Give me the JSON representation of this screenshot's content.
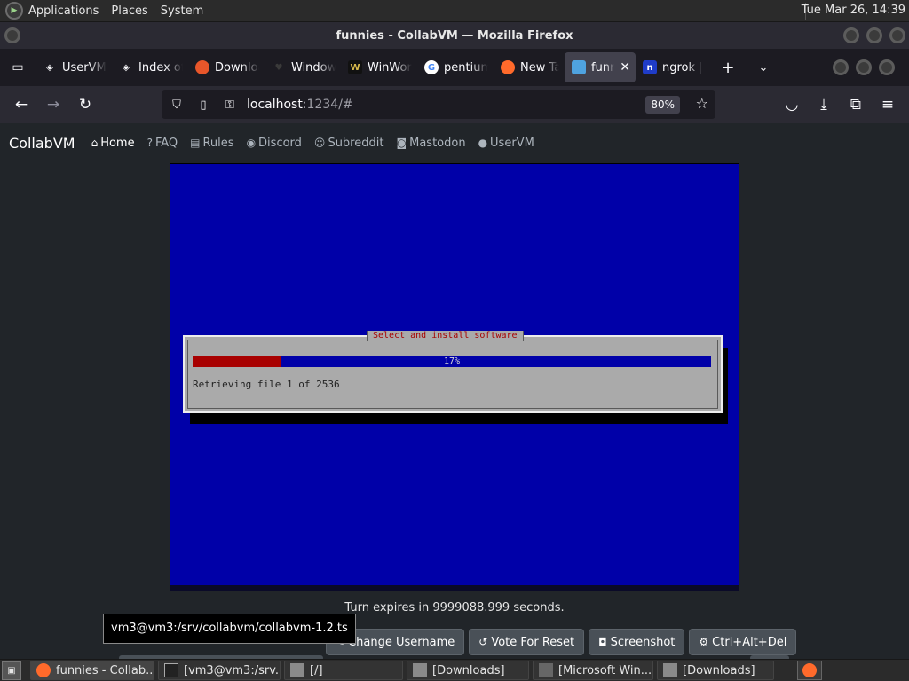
{
  "top_panel": {
    "menus": [
      "Applications",
      "Places",
      "System"
    ],
    "clock": "Tue Mar 26, 14:39"
  },
  "window": {
    "title": "funnies - CollabVM — Mozilla Firefox"
  },
  "tabs": [
    {
      "label": "UserVM",
      "icon": "cube-icon",
      "color": "#ffffff"
    },
    {
      "label": "Index of",
      "icon": "cube-icon",
      "color": "#ffffff"
    },
    {
      "label": "Download",
      "icon": "colorful-logo-icon",
      "color": "#e8562a"
    },
    {
      "label": "Windows",
      "icon": "heart-icon",
      "color": "#3a3a3a"
    },
    {
      "label": "WinWorld",
      "icon": "winworld-icon",
      "color": "#d6b94a"
    },
    {
      "label": "pentium",
      "icon": "google-icon",
      "color": "#ffffff"
    },
    {
      "label": "New Tab",
      "icon": "firefox-icon",
      "color": "#ff6a2b"
    },
    {
      "label": "funnies",
      "icon": "monitor-icon",
      "color": "#4fa3e0"
    },
    {
      "label": "ngrok | ",
      "icon": "ngrok-icon",
      "color": "#1f3cc8"
    }
  ],
  "navbar": {
    "url_host": "localhost",
    "url_path": ":1234/#",
    "zoom": "80%"
  },
  "site": {
    "brand": "CollabVM",
    "links": [
      "Home",
      "FAQ",
      "Rules",
      "Discord",
      "Subreddit",
      "Mastodon",
      "UserVM"
    ]
  },
  "vm": {
    "dialog_title": "Select and install software",
    "progress_percent": 17,
    "progress_label": "17%",
    "status": "Retrieving file 1 of 2536",
    "screen_bg": "#0000a8",
    "progress_fill": "#a80000"
  },
  "turn_text": "Turn expires in 9999088.999 seconds.",
  "buttons": {
    "change_username": "Change Username",
    "vote_reset": "Vote For Reset",
    "screenshot": "Screenshot",
    "ctrl_alt_del": "Ctrl+Alt+Del"
  },
  "tooltip": "vm3@vm3:/srv/collabvm/collabvm-1.2.ts",
  "taskbar": {
    "items": [
      {
        "label": "funnies - Collab...",
        "icon": "firefox-icon"
      },
      {
        "label": "[vm3@vm3:/srv...",
        "icon": "terminal-icon"
      },
      {
        "label": "[/]",
        "icon": "folder-icon"
      },
      {
        "label": "[Downloads]",
        "icon": "folder-icon"
      },
      {
        "label": "[Microsoft Win...",
        "icon": "window-icon"
      },
      {
        "label": "[Downloads]",
        "icon": "folder-icon"
      }
    ]
  }
}
